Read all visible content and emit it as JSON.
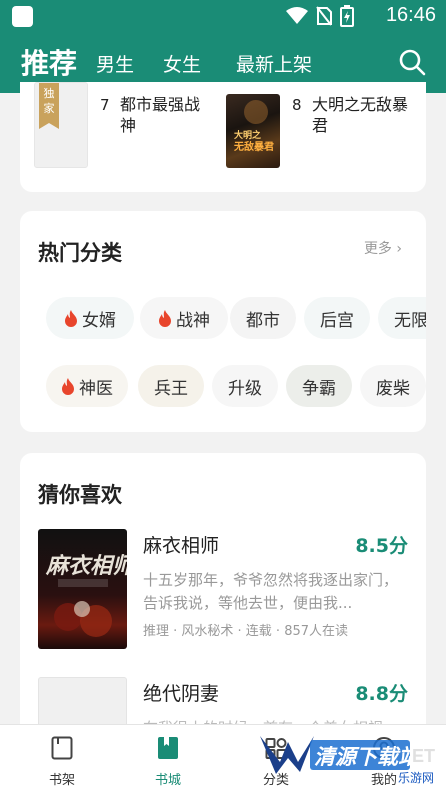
{
  "status_bar": {
    "time": "16:46"
  },
  "top_nav": {
    "tabs": [
      {
        "label": "推荐",
        "active": true
      },
      {
        "label": "男生"
      },
      {
        "label": "女生"
      },
      {
        "label": "最新上架"
      }
    ],
    "search_icon": "search-icon"
  },
  "ranking": {
    "items": [
      {
        "rank": "7",
        "title": "都市最强战神",
        "badge": "独家"
      },
      {
        "rank": "8",
        "title": "大明之无敌暴君"
      }
    ]
  },
  "categories": {
    "title": "热门分类",
    "more": "更多",
    "row1": [
      {
        "label": "女婿",
        "hot": true
      },
      {
        "label": "战神",
        "hot": true
      },
      {
        "label": "都市"
      },
      {
        "label": "后宫"
      },
      {
        "label": "无限"
      }
    ],
    "row2": [
      {
        "label": "神医",
        "hot": true
      },
      {
        "label": "兵王"
      },
      {
        "label": "升级"
      },
      {
        "label": "争霸"
      },
      {
        "label": "废柴"
      }
    ]
  },
  "recommend": {
    "title": "猜你喜欢",
    "books": [
      {
        "title": "麻衣相师",
        "score": "8.5分",
        "desc": "十五岁那年，爷爷忽然将我逐出家门，告诉我说，等他去世，便由我...",
        "meta": "推理 · 风水秘术 · 连载 · 857人在读"
      },
      {
        "title": "绝代阴妻",
        "score": "8.8分",
        "desc": "在我很小的时候，首有一个美女相视..."
      }
    ]
  },
  "bottom_nav": {
    "items": [
      {
        "label": "书架"
      },
      {
        "label": "书城",
        "active": true
      },
      {
        "label": "分类"
      },
      {
        "label": "我的"
      }
    ]
  },
  "watermark": {
    "text": "清源下载站",
    "sub": "乐游网"
  }
}
